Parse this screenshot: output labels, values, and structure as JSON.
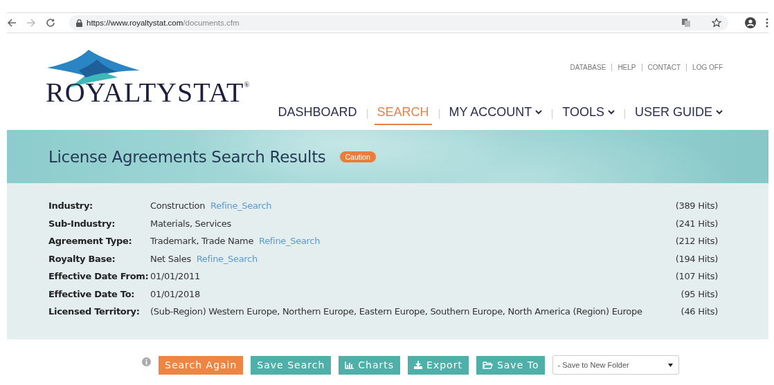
{
  "browser": {
    "url_host": "https://www.royaltystat.com",
    "url_path": "/documents.cfm"
  },
  "logo": {
    "text": "ROYALTYSTAT",
    "mark": "®"
  },
  "top_links": [
    {
      "label": "DATABASE"
    },
    {
      "label": "HELP"
    },
    {
      "label": "CONTACT"
    },
    {
      "label": "LOG OFF"
    }
  ],
  "nav": [
    {
      "label": "DASHBOARD",
      "selected": false,
      "has_menu": false
    },
    {
      "label": "SEARCH",
      "selected": true,
      "has_menu": false
    },
    {
      "label": "MY ACCOUNT",
      "selected": false,
      "has_menu": true
    },
    {
      "label": "TOOLS",
      "selected": false,
      "has_menu": true
    },
    {
      "label": "USER GUIDE",
      "selected": false,
      "has_menu": true
    }
  ],
  "banner": {
    "title": "License Agreements Search Results",
    "badge": "Caution"
  },
  "criteria": [
    {
      "label": "Industry:",
      "value": "Construction",
      "link": "Refine_Search",
      "hits": "(389 Hits)"
    },
    {
      "label": "Sub-Industry:",
      "value": "Materials, Services",
      "hits": "(241 Hits)"
    },
    {
      "label": "Agreement Type:",
      "value": "Trademark, Trade Name",
      "link": "Refine_Search",
      "hits": "(212 Hits)"
    },
    {
      "label": "Royalty Base:",
      "value": "Net Sales",
      "link": "Refine_Search",
      "hits": "(194 Hits)"
    },
    {
      "label": "Effective Date From:",
      "value": "01/01/2011",
      "hits": "(107 Hits)"
    },
    {
      "label": "Effective Date To:",
      "value": "01/01/2018",
      "hits": "(95 Hits)"
    },
    {
      "label": "Licensed Territory:",
      "value": "(Sub-Region) Western Europe, Northern Europe, Eastern Europe, Southern Europe, North America (Region) Europe",
      "hits": "(46 Hits)"
    }
  ],
  "actions": [
    {
      "label": "Search Again",
      "kind": "primary"
    },
    {
      "label": "Save Search",
      "kind": "plain"
    },
    {
      "label": "Charts",
      "kind": "chart"
    },
    {
      "label": "Export",
      "kind": "download"
    },
    {
      "label": "Save To",
      "kind": "folder"
    }
  ],
  "folder_select": {
    "value": "- Save to New Folder"
  }
}
